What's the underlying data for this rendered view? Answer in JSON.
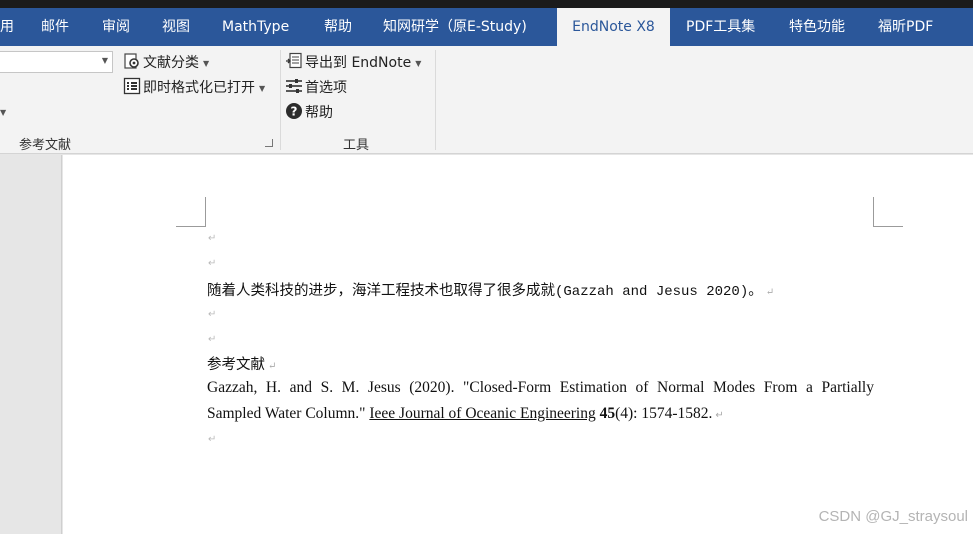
{
  "tabs": {
    "t0": "用",
    "t1": "邮件",
    "t2": "审阅",
    "t3": "视图",
    "t4": "MathType",
    "t5": "帮助",
    "t6": "知网研学（原E-Study)",
    "t7": "EndNote X8",
    "t8": "PDF工具集",
    "t9": "特色功能",
    "t10": "福昕PDF"
  },
  "ribbon": {
    "style_dropdown_value": "",
    "categorize_label": "文献分类",
    "instant_format_label": "即时格式化已打开",
    "export_label": "导出到 EndNote",
    "preferences_label": "首选项",
    "help_label": "帮助",
    "group_citations": "参考文献",
    "group_tools": "工具"
  },
  "document": {
    "body_text": "随着人类科技的进步，海洋工程技术也取得了很多成就",
    "citation": "(Gazzah and Jesus 2020)",
    "body_end": "。",
    "ref_heading": "参考文献",
    "ref_line1": "Gazzah, H. and S. M. Jesus (2020). \"Closed-Form Estimation of Normal Modes From a Partially",
    "ref_line2_pre": "Sampled Water Column.\"",
    "ref_journal": "Ieee Journal of Oceanic Engineering",
    "ref_volume": "45",
    "ref_rest": "(4): 1574-1582.",
    "para_mark": "↵"
  },
  "watermark": "CSDN @GJ_straysoul"
}
